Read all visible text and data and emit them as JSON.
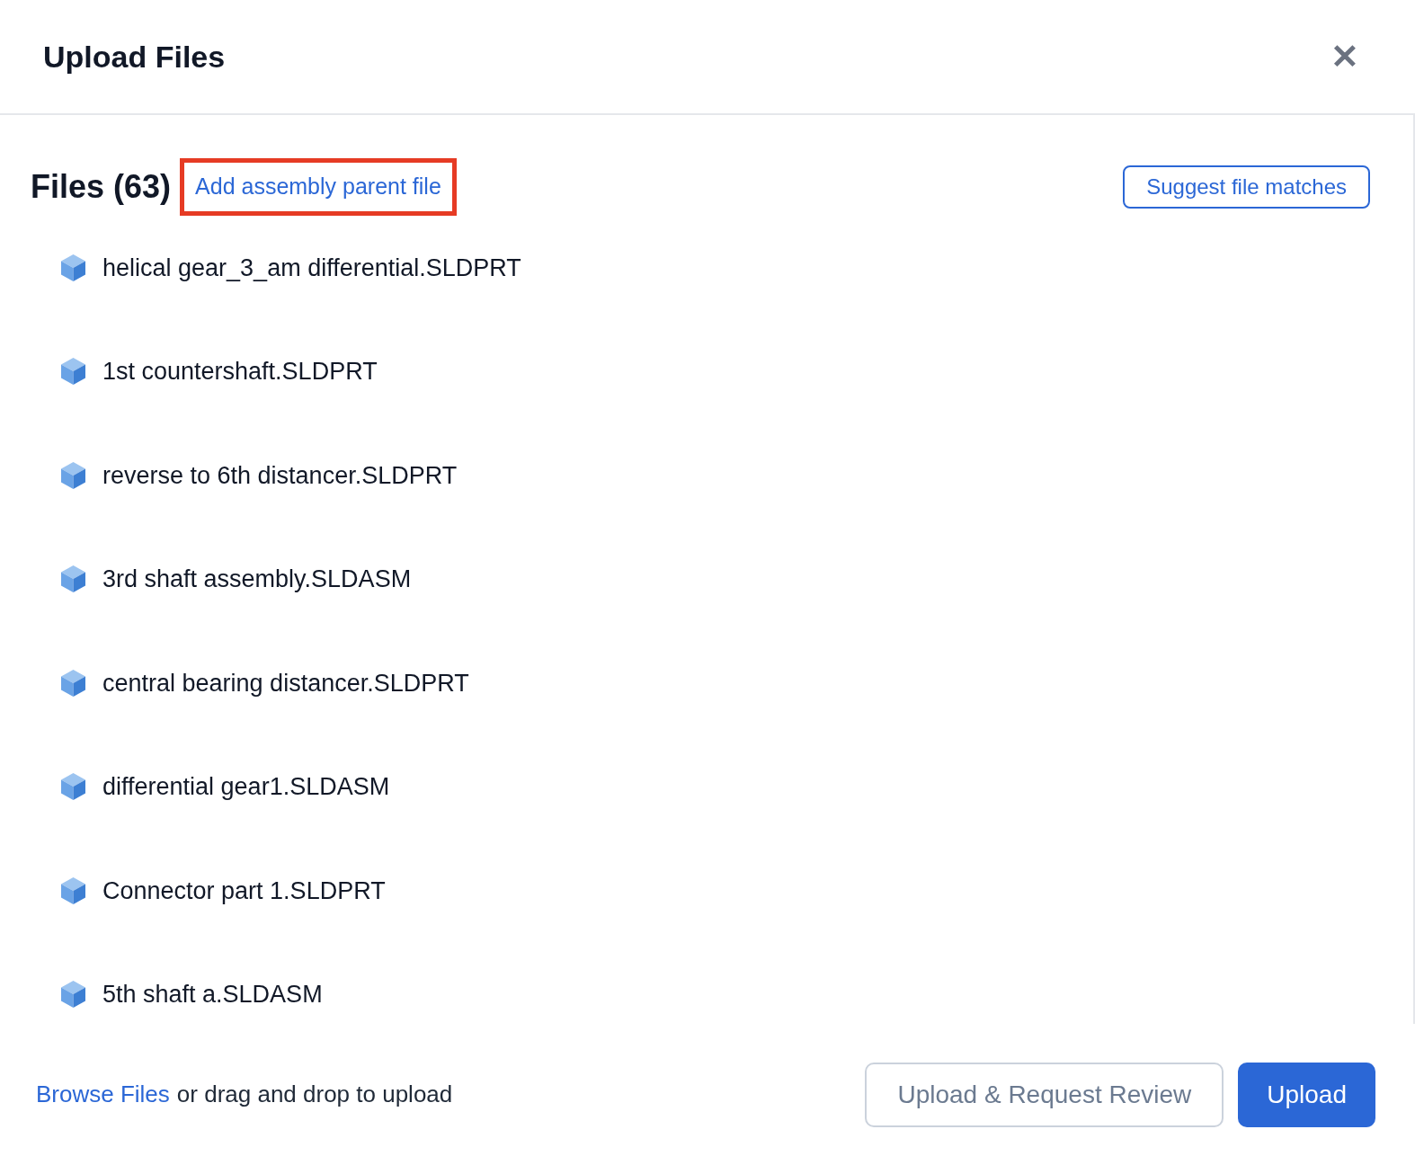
{
  "dialog": {
    "title": "Upload Files",
    "close_label": "✕"
  },
  "files": {
    "heading": "Files (63)",
    "parent_link": {
      "label": "Add assembly parent file",
      "highlighted": true
    },
    "suggest_button": "Suggest file matches",
    "items": [
      {
        "name": "helical gear_3_am differential.SLDPRT"
      },
      {
        "name": "1st countershaft.SLDPRT"
      },
      {
        "name": "reverse to 6th distancer.SLDPRT"
      },
      {
        "name": "3rd shaft assembly.SLDASM"
      },
      {
        "name": "central bearing distancer.SLDPRT"
      },
      {
        "name": "differential gear1.SLDASM"
      },
      {
        "name": "Connector part 1.SLDPRT"
      },
      {
        "name": "5th shaft a.SLDASM"
      }
    ]
  },
  "footer": {
    "browse_link": "Browse Files",
    "drop_hint": "or drag and drop to upload",
    "buttons": [
      {
        "label": "Upload & Request Review",
        "kind": "secondary"
      },
      {
        "label": "Upload",
        "kind": "primary"
      }
    ]
  }
}
